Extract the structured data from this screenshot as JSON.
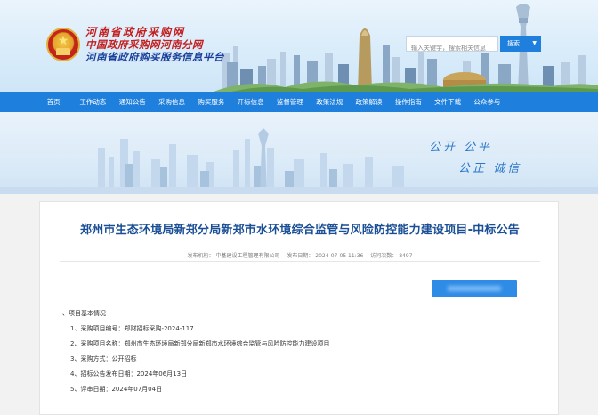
{
  "header": {
    "brand_line1": "河南省政府采购网",
    "brand_line2": "中国政府采购网河南分网",
    "brand_line3": "河南省政府购买服务信息平台",
    "search_placeholder": "输入关键字，搜索相关信息",
    "search_button": "搜索",
    "colors": {
      "brand_red": "#c31d1d",
      "brand_blue": "#1a3f9a",
      "nav_blue": "#1f7fdc"
    }
  },
  "nav": {
    "items": [
      "首页",
      "工作动态",
      "通知公告",
      "采购信息",
      "购买服务",
      "开标信息",
      "监督管理",
      "政策法规",
      "政策解读",
      "操作指南",
      "文件下载",
      "公众参与"
    ]
  },
  "banner": {
    "slogan_top": "公开   公平",
    "slogan_bottom": "公正   诚信"
  },
  "article": {
    "title": "郑州市生态环境局新郑分局新郑市水环境综合监管与风险防控能力建设项目-中标公告",
    "meta_agency": "发布机构：  中基建设工程管理有限公司",
    "meta_time": "发布日期：  2024-07-05 11:36",
    "meta_views": "访问次数：  8497",
    "section_heading": "一、项目基本情况",
    "rows": [
      "1、采购项目编号：郑财招标采购-2024-117",
      "2、采购项目名称：郑州市生态环境局新郑分局新郑市水环境综合监管与风险防控能力建设项目",
      "3、采购方式：公开招标",
      "4、招标公告发布日期：2024年06月13日",
      "5、评审日期：2024年07月04日"
    ]
  }
}
